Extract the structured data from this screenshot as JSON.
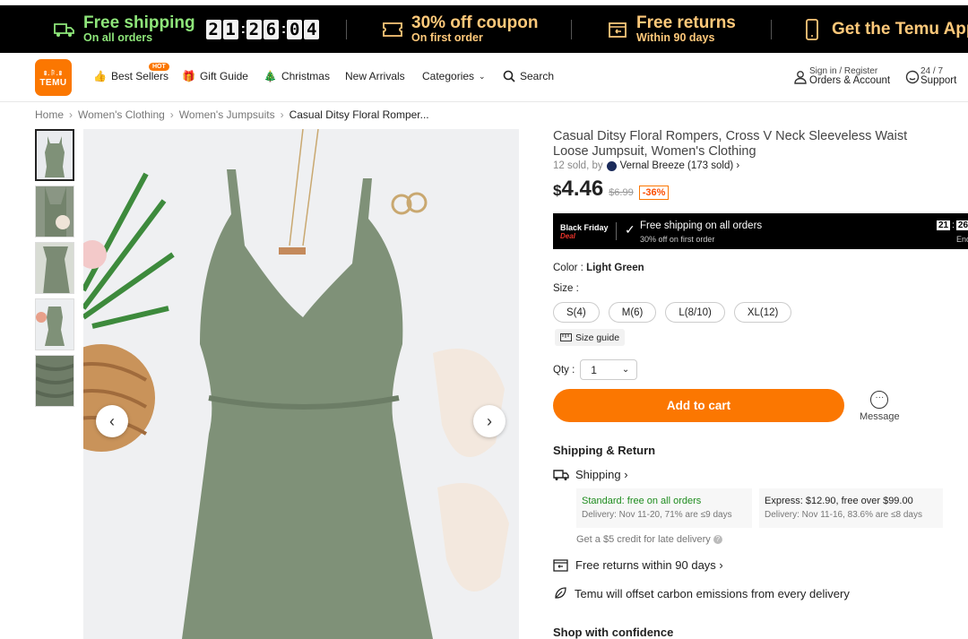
{
  "promo": {
    "free_shipping_title": "Free shipping",
    "free_shipping_sub": "On all orders",
    "timer": [
      "2",
      "1",
      "2",
      "6",
      "0",
      "4"
    ],
    "coupon_title": "30% off coupon",
    "coupon_sub": "On first order",
    "returns_title": "Free returns",
    "returns_sub": "Within 90 days",
    "app_title": "Get the Temu App"
  },
  "nav": {
    "logo_top": "ꗚ.ꑍ.ꗚ",
    "logo_bottom": "TEMU",
    "best_sellers": "Best Sellers",
    "hot_badge": "HOT",
    "gift_guide": "Gift Guide",
    "christmas": "Christmas",
    "new_arrivals": "New Arrivals",
    "categories": "Categories",
    "search": "Search",
    "sign_in": "Sign in / Register",
    "orders": "Orders & Account",
    "support_top": "24 / 7",
    "support": "Support"
  },
  "breadcrumb": {
    "home": "Home",
    "c1": "Women's Clothing",
    "c2": "Women's Jumpsuits",
    "current": "Casual Ditsy Floral Romper..."
  },
  "product": {
    "title": "Casual Ditsy Floral Rompers, Cross V Neck Sleeveless Waist Loose Jumpsuit, Women's Clothing",
    "sold": "12 sold, by",
    "store": "Vernal Breeze (173 sold) ›",
    "currency": "$",
    "price": "4.46",
    "old_price": "$6.99",
    "discount": "-36%",
    "color_label": "Color :",
    "color_value": "Light Green",
    "size_label": "Size :",
    "sizes": [
      "S(4)",
      "M(6)",
      "L(8/10)",
      "XL(12)"
    ],
    "size_guide": "Size guide",
    "qty_label": "Qty :",
    "qty_value": "1",
    "add_to_cart": "Add to cart",
    "message": "Message"
  },
  "black_friday": {
    "label1": "Black Friday",
    "label2": "Deal",
    "title": "Free shipping on all orders",
    "sub": "30% off on first order",
    "timer": [
      "21",
      "26"
    ],
    "ends": "End"
  },
  "shipping": {
    "heading": "Shipping & Return",
    "shipping_link": "Shipping ›",
    "standard_title": "Standard: free on all orders",
    "standard_detail": "Delivery: Nov 11-20, 71% are ≤9 days",
    "express_title": "Express: $12.90, free over $99.00",
    "express_detail": "Delivery: Nov 11-16, 83.6% are ≤8 days",
    "credit": "Get a $5 credit for late delivery",
    "returns": "Free returns within 90 days ›",
    "carbon": "Temu will offset carbon emissions from every delivery",
    "confidence": "Shop with confidence"
  },
  "colors": {
    "accent": "#fb7701",
    "promo_green": "#8ee67a",
    "promo_amber": "#ffc97a",
    "standard_green": "#1e8c1e"
  }
}
